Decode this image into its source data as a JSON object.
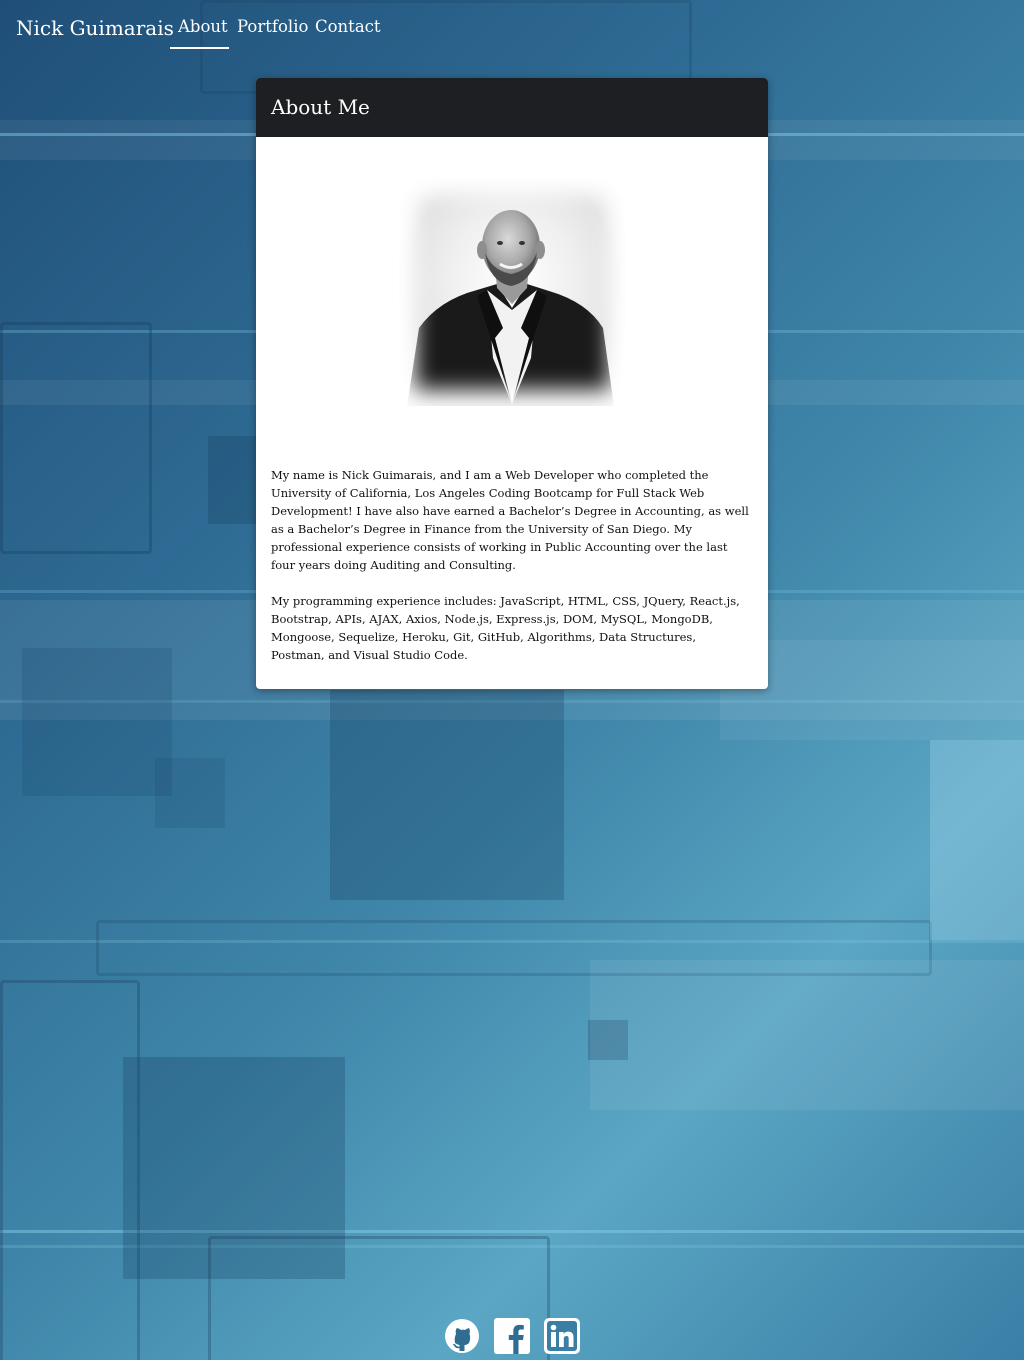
{
  "nav": {
    "brand": "Nick Guimarais",
    "links": [
      "About",
      "Portfolio",
      "Contact"
    ],
    "active": "About"
  },
  "card": {
    "title": "About Me",
    "paragraphs": [
      "My name is Nick Guimarais, and I am a Web Developer who completed the University of California, Los Angeles Coding Bootcamp for Full Stack Web Development! I have also have earned a Bachelor’s Degree in Accounting, as well as a Bachelor’s Degree in Finance from the University of San Diego. My professional experience consists of working in Public Accounting over the last four years doing Auditing and Consulting.",
      "My programming experience includes: JavaScript, HTML, CSS, JQuery, React.js, Bootstrap, APIs, AJAX, Axios, Node.js, Express.js, DOM, MySQL, MongoDB, Mongoose, Sequelize, Heroku, Git, GitHub, Algorithms, Data Structures, Postman, and Visual Studio Code."
    ]
  },
  "social": {
    "icons": [
      "github-icon",
      "facebook-icon",
      "linkedin-icon"
    ]
  },
  "colors": {
    "header_bg": "#1e1f22",
    "card_bg": "#ffffff",
    "page_bg": "#2e6a93"
  }
}
